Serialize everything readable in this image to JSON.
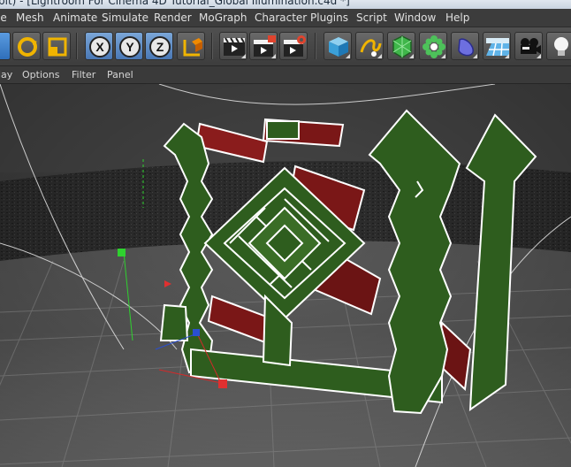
{
  "window": {
    "title": "bit) - [Lightroom For Cinema 4D Tutorial_Global Illumination.c4d *]"
  },
  "menubar": {
    "items": [
      "File",
      "Mesh",
      "Animate",
      "Simulate",
      "Render",
      "MoGraph",
      "Character",
      "Plugins",
      "Script",
      "Window",
      "Help"
    ],
    "file_partial": "le"
  },
  "toolbar": {
    "axis_labels": [
      "X",
      "Y",
      "Z"
    ]
  },
  "panel_menu": {
    "items": [
      "lay",
      "Options",
      "Filter",
      "Panel"
    ]
  },
  "colors": {
    "accent_blue": "#3d7cc9",
    "axis_red": "#d12a2a",
    "axis_green": "#2fd12f",
    "axis_blue": "#2a4fd1",
    "model_green": "#2e5d1e",
    "model_red": "#7a1717"
  },
  "icons": {
    "toolbar": [
      "rotate-icon",
      "scale-icon",
      "x-axis-icon",
      "y-axis-icon",
      "z-axis-icon",
      "coordinate-system-icon",
      "render-view-icon",
      "render-picture-viewer-icon",
      "render-settings-icon",
      "cube-icon",
      "spline-pen-icon",
      "nurbs-icon",
      "array-icon",
      "deformer-icon",
      "floor-icon",
      "camera-icon",
      "light-icon"
    ]
  }
}
